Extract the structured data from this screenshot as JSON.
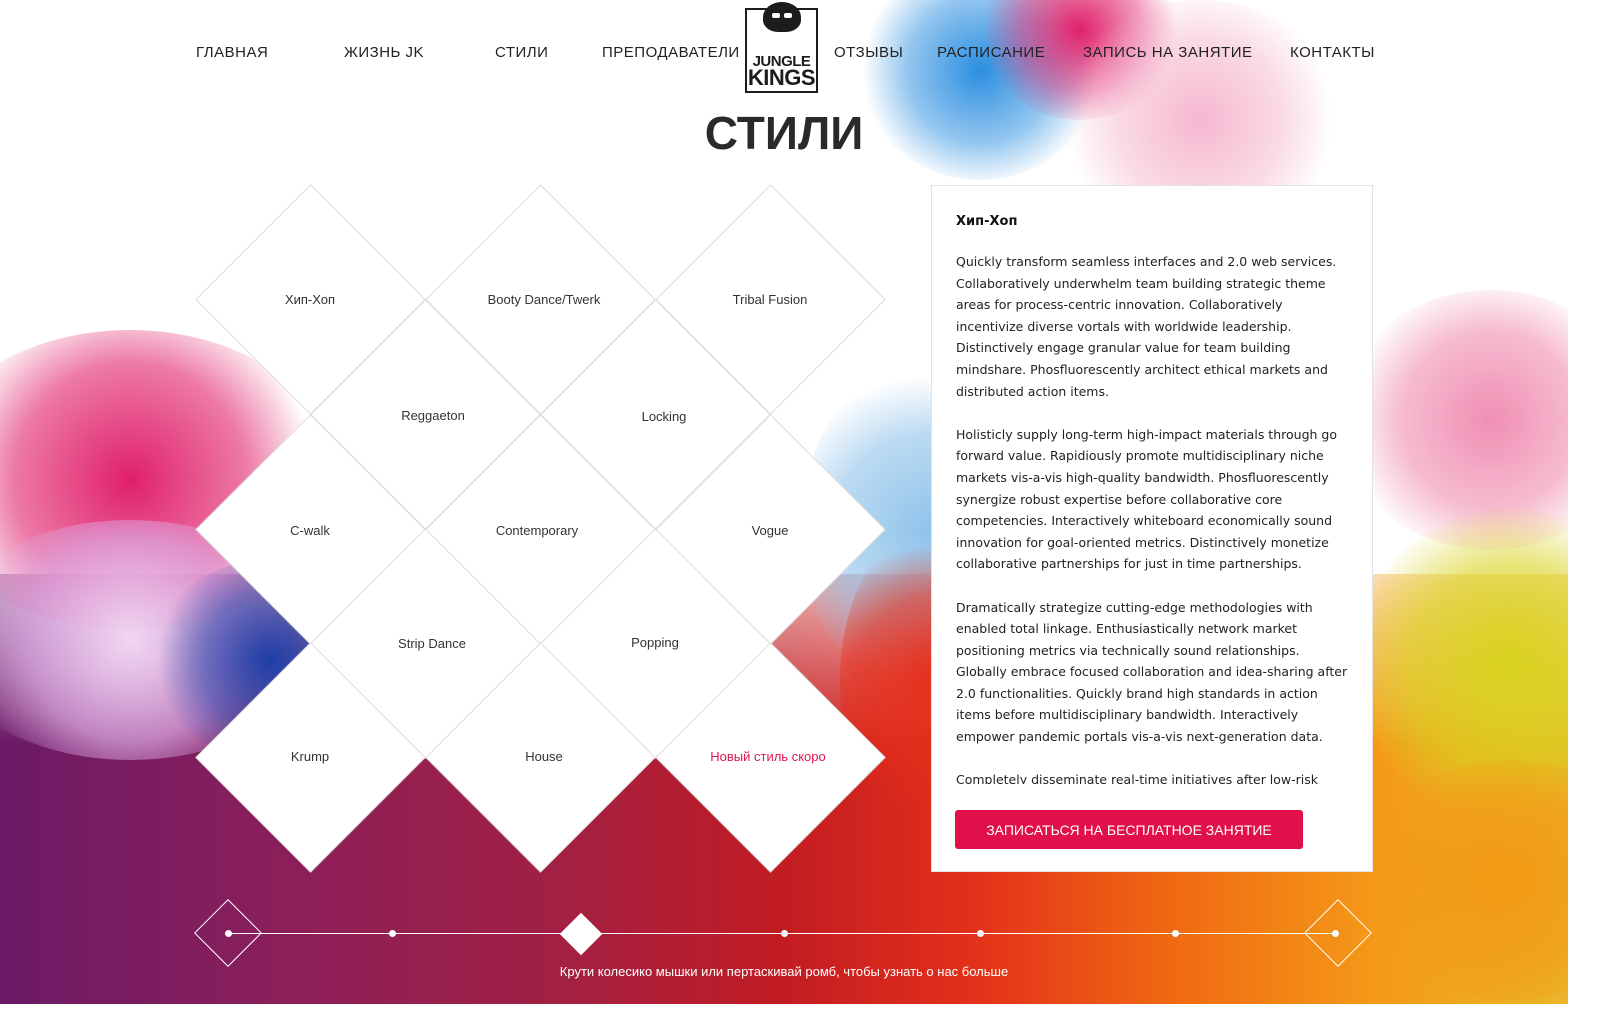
{
  "header": {
    "nav": [
      {
        "label": "ГЛАВНАЯ"
      },
      {
        "label": "ЖИЗНЬ JK"
      },
      {
        "label": "СТИЛИ"
      },
      {
        "label": "ПРЕПОДАВАТЕЛИ"
      },
      {
        "label": "ОТЗЫВЫ"
      },
      {
        "label": "РАСПИСАНИЕ"
      },
      {
        "label": "ЗАПИСЬ НА ЗАНЯТИЕ"
      },
      {
        "label": "КОНТАКТЫ"
      }
    ],
    "logo": {
      "line1": "JUNGLE",
      "line2": "KINGS"
    }
  },
  "page_title": "СТИЛИ",
  "styles": [
    {
      "label": "Хип-Хоп"
    },
    {
      "label": "Booty Dance/Twerk"
    },
    {
      "label": "Tribal Fusion"
    },
    {
      "label": "Reggaeton"
    },
    {
      "label": "Locking"
    },
    {
      "label": "C-walk"
    },
    {
      "label": "Contemporary"
    },
    {
      "label": "Vogue"
    },
    {
      "label": "Strip Dance"
    },
    {
      "label": "Popping"
    },
    {
      "label": "Krump"
    },
    {
      "label": "House"
    },
    {
      "label": "Новый стиль скоро"
    }
  ],
  "panel": {
    "title": "Хип-Хоп",
    "paragraphs": [
      "Quickly transform seamless interfaces and 2.0 web services. Collaboratively underwhelm team building strategic theme areas for process-centric innovation. Collaboratively incentivize diverse vortals with worldwide leadership. Distinctively engage granular value for team building mindshare. Phosfluorescently architect ethical markets and distributed action items.",
      "Holisticly supply long-term high-impact materials through go forward value. Rapidiously promote multidisciplinary niche markets vis-a-vis high-quality bandwidth. Phosfluorescently synergize robust expertise before collaborative core competencies. Interactively whiteboard economically sound innovation for goal-oriented metrics. Distinctively monetize collaborative partnerships for just in time partnerships.",
      "Dramatically strategize cutting-edge methodologies with enabled total linkage. Enthusiastically network market positioning metrics via technically sound relationships. Globally embrace focused collaboration and idea-sharing after 2.0 functionalities. Quickly brand high standards in action items before multidisciplinary bandwidth. Interactively empower pandemic portals vis-a-vis next-generation data.",
      "Completely disseminate real-time initiatives after low-risk high-yield infrastructures. Distinctively iterate economically"
    ],
    "cta_label": "ЗАПИСАТЬСЯ НА БЕСПЛАТНОЕ ЗАНЯТИЕ"
  },
  "slider": {
    "hint": "Крути колесико мышки или пертаскивай ромб, чтобы узнать о нас больше"
  },
  "colors": {
    "accent": "#e0104a",
    "text": "#222222",
    "diamond_border": "#dcdcdc"
  }
}
